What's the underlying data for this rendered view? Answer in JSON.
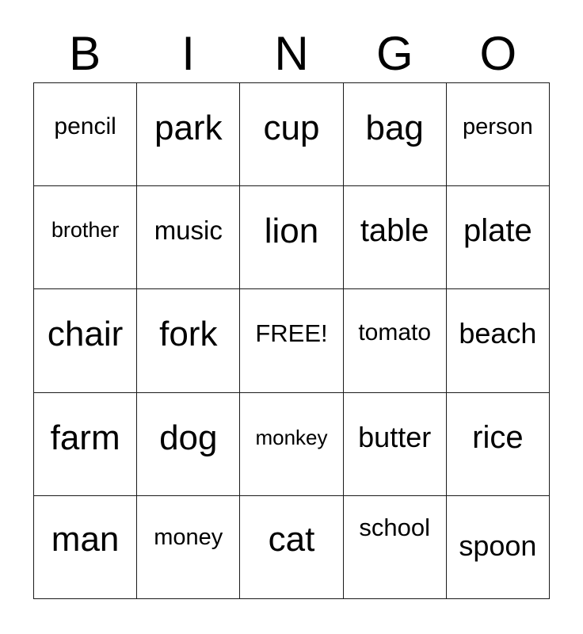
{
  "card": {
    "type": "bingo-card",
    "columns": 5,
    "rows": 5,
    "header": {
      "letters": [
        "B",
        "I",
        "N",
        "G",
        "O"
      ]
    },
    "free_space": {
      "label": "FREE!",
      "row": 2,
      "column": 2
    },
    "grid": [
      [
        {
          "text": "pencil",
          "size": 30,
          "offset": 40
        },
        {
          "text": "park",
          "size": 44,
          "offset": 35
        },
        {
          "text": "cup",
          "size": 44,
          "offset": 35
        },
        {
          "text": "bag",
          "size": 44,
          "offset": 35
        },
        {
          "text": "person",
          "size": 29,
          "offset": 41
        }
      ],
      [
        {
          "text": "brother",
          "size": 27,
          "offset": 42
        },
        {
          "text": "music",
          "size": 33,
          "offset": 39
        },
        {
          "text": "lion",
          "size": 44,
          "offset": 35
        },
        {
          "text": "table",
          "size": 40,
          "offset": 36
        },
        {
          "text": "plate",
          "size": 40,
          "offset": 36
        }
      ],
      [
        {
          "text": "chair",
          "size": 44,
          "offset": 35
        },
        {
          "text": "fork",
          "size": 44,
          "offset": 35
        },
        {
          "text": "FREE!",
          "size": 31,
          "offset": 40
        },
        {
          "text": "tomato",
          "size": 30,
          "offset": 40
        },
        {
          "text": "beach",
          "size": 36,
          "offset": 38
        }
      ],
      [
        {
          "text": "farm",
          "size": 44,
          "offset": 35
        },
        {
          "text": "dog",
          "size": 44,
          "offset": 35
        },
        {
          "text": "monkey",
          "size": 26,
          "offset": 43
        },
        {
          "text": "butter",
          "size": 36,
          "offset": 38
        },
        {
          "text": "rice",
          "size": 40,
          "offset": 36
        }
      ],
      [
        {
          "text": "man",
          "size": 44,
          "offset": 33
        },
        {
          "text": "money",
          "size": 29,
          "offset": 38
        },
        {
          "text": "cat",
          "size": 44,
          "offset": 33
        },
        {
          "text": "school",
          "size": 31,
          "offset": 24
        },
        {
          "text": "spoon",
          "size": 36,
          "offset": 45
        }
      ]
    ]
  },
  "colors": {
    "border": "#1a1a1a",
    "text": "#000000",
    "background": "#ffffff"
  }
}
